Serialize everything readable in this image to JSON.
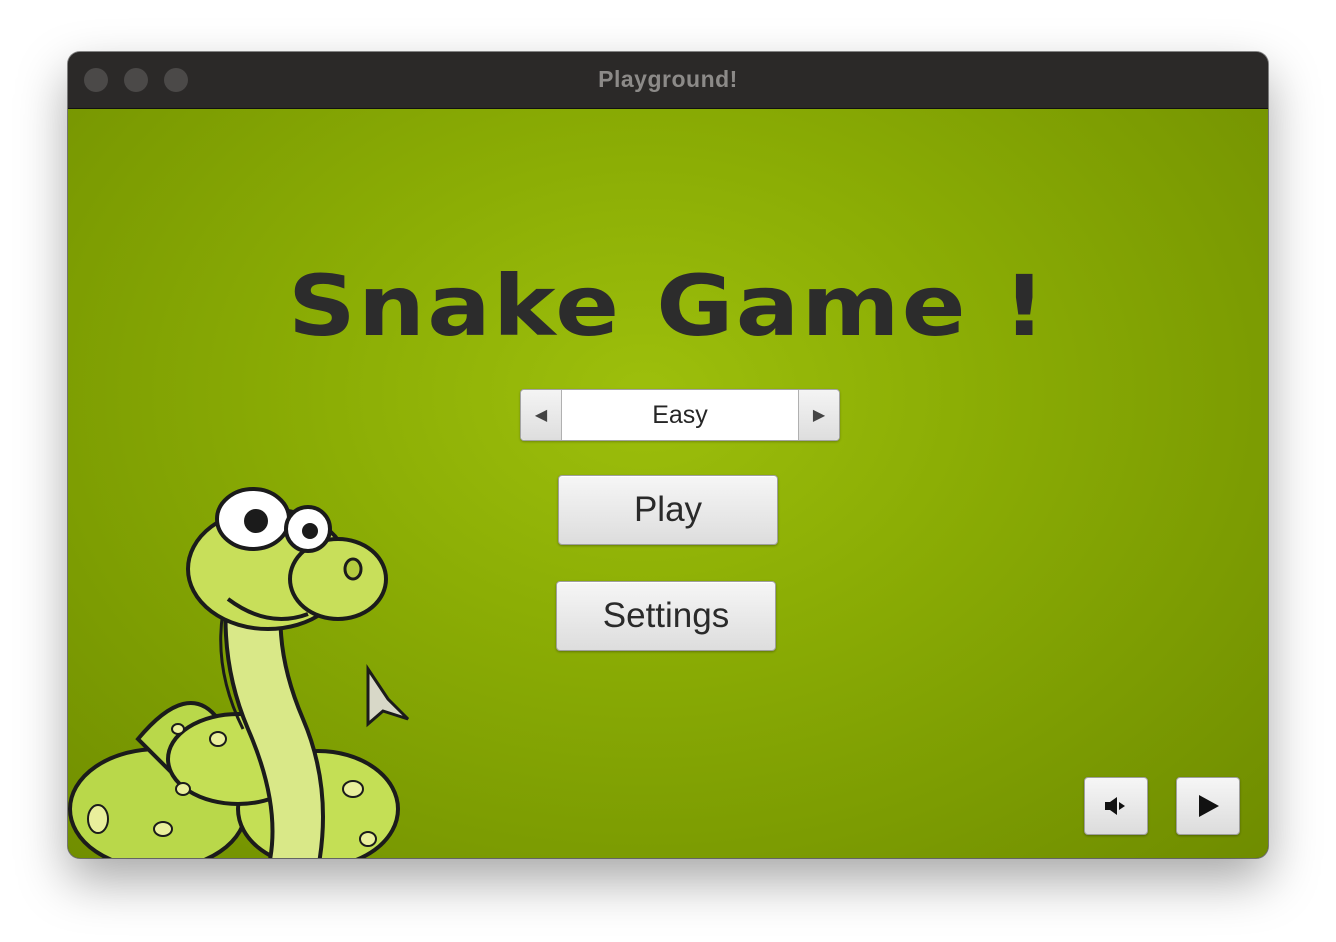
{
  "window": {
    "title": "Playground!"
  },
  "game": {
    "title": "Snake Game !",
    "difficulty": {
      "value": "Easy",
      "decrease_icon": "triangle-left-icon",
      "increase_icon": "triangle-right-icon"
    },
    "buttons": {
      "play": "Play",
      "settings": "Settings"
    },
    "controls": {
      "sound_icon": "speaker-icon",
      "play_icon": "play-triangle-icon"
    }
  },
  "colors": {
    "background_green": "#8cae05",
    "title_text": "#2c2c2c",
    "titlebar": "#2b2928"
  }
}
